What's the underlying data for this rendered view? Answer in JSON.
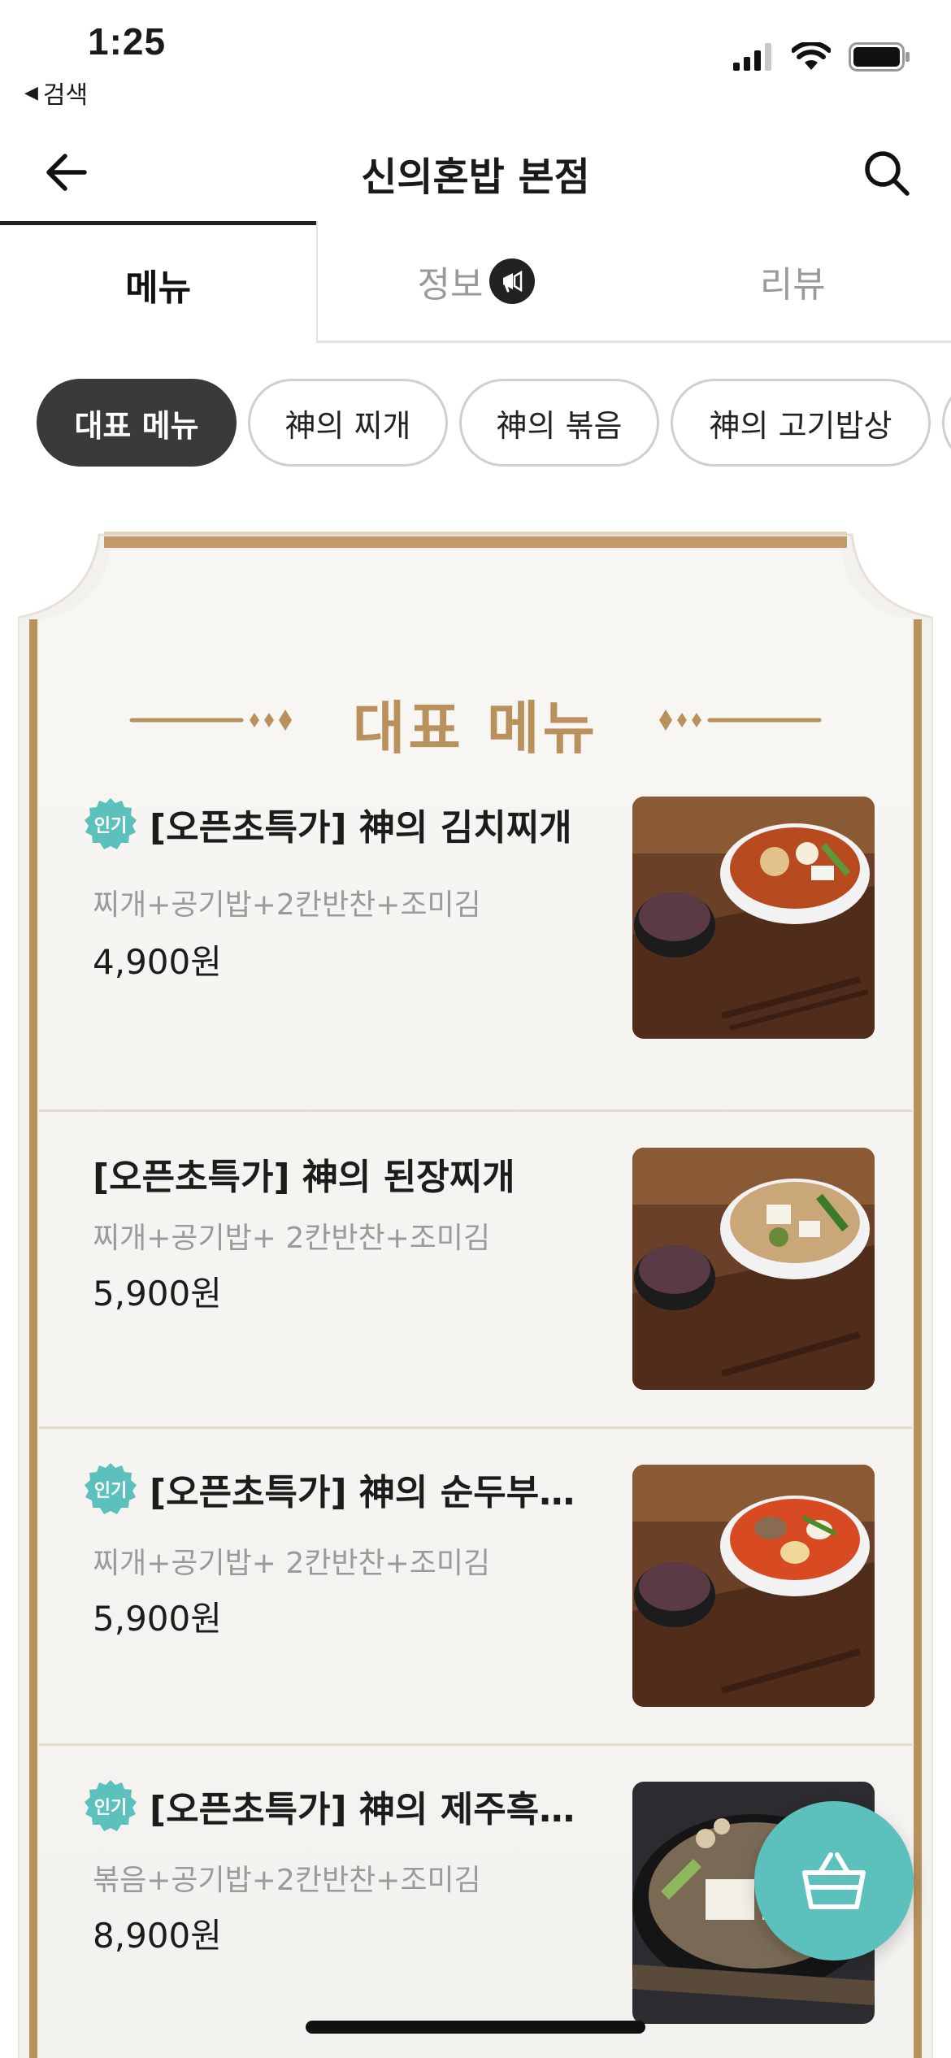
{
  "status_bar": {
    "time": "1:25",
    "back_label": "검색"
  },
  "header": {
    "title": "신의혼밥 본점"
  },
  "tabs": [
    {
      "label": "메뉴",
      "active": true
    },
    {
      "label": "정보",
      "active": false
    },
    {
      "label": "리뷰",
      "active": false
    }
  ],
  "categories": [
    {
      "label": "대표 메뉴",
      "active": true
    },
    {
      "label": "神의 찌개",
      "active": false
    },
    {
      "label": "神의 볶음",
      "active": false
    },
    {
      "label": "神의 고기밥상",
      "active": false
    }
  ],
  "section": {
    "title": "대표 메뉴"
  },
  "badge_text": "인기",
  "menu_items": [
    {
      "name": "[오픈초특가] 神의 김치찌개",
      "desc": "찌개+공기밥+2칸반찬+조미김",
      "price": "4,900원",
      "popular": true,
      "image": "kimchi-jjigae-photo"
    },
    {
      "name": "[오픈초특가] 神의 된장찌개",
      "desc": "찌개+공기밥+ 2칸반찬+조미김",
      "price": "5,900원",
      "popular": false,
      "image": "doenjang-jjigae-photo"
    },
    {
      "name": "[오픈초특가] 神의 순두부찌개",
      "desc": "찌개+공기밥+ 2칸반찬+조미김",
      "price": "5,900원",
      "popular": true,
      "image": "sundubu-jjigae-photo"
    },
    {
      "name": "[오픈초특가] 神의 제주흑돼…",
      "desc": "볶음+공기밥+2칸반찬+조미김",
      "price": "8,900원",
      "popular": true,
      "image": "jeju-pork-photo"
    }
  ],
  "colors": {
    "accent_gold": "#b8915d",
    "fab_teal": "#5cc0bd",
    "badge_teal": "#5cc0bd",
    "chip_active": "#3a3a3a"
  },
  "icons": {
    "back": "arrow-left-icon",
    "search": "search-icon",
    "info_badge": "megaphone-icon",
    "cart": "basket-icon"
  }
}
